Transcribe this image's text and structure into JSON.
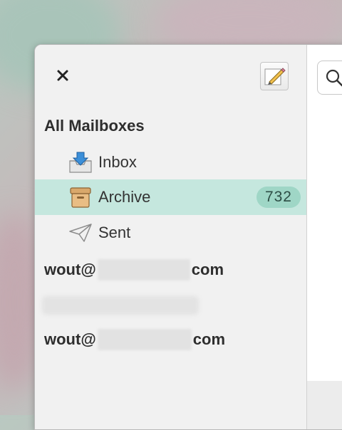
{
  "sidebar": {
    "section_title": "All Mailboxes",
    "mailboxes": [
      {
        "label": "Inbox",
        "icon": "inbox-tray-icon"
      },
      {
        "label": "Archive",
        "icon": "archive-box-icon",
        "count": "732",
        "selected": true
      },
      {
        "label": "Sent",
        "icon": "paper-plane-icon"
      }
    ],
    "accounts": [
      {
        "prefix": "wout@",
        "suffix": "com"
      },
      {
        "prefix": "wout@",
        "suffix": "com"
      }
    ]
  },
  "colors": {
    "selected_bg": "#c5e7de",
    "badge_bg": "#9fd6c6"
  }
}
